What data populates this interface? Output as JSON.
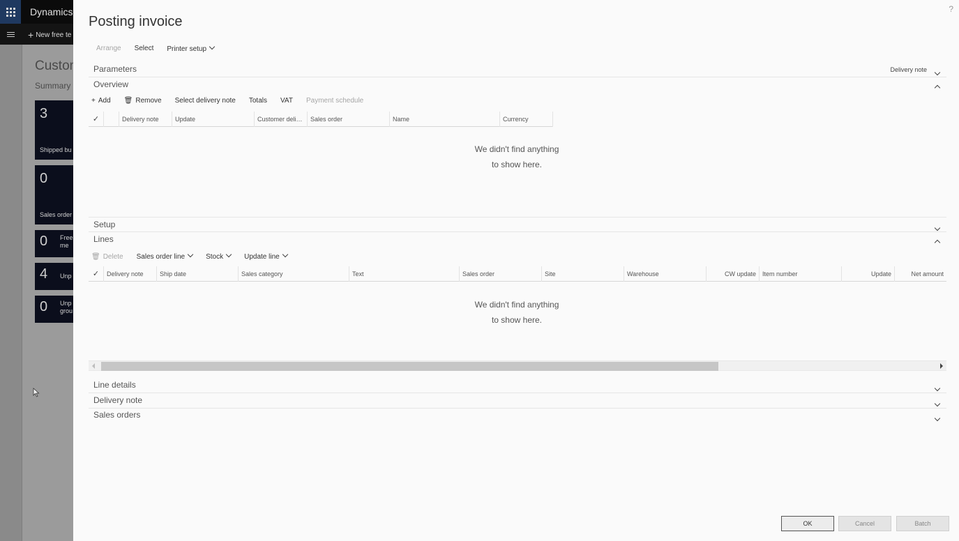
{
  "background": {
    "app_name": "Dynamics",
    "new_button": "New free te",
    "page_title": "Custon",
    "summary": "Summary",
    "tiles": [
      {
        "count": "3",
        "label": "Shipped bu"
      },
      {
        "count": "0",
        "label": "Sales order"
      },
      {
        "count": "0",
        "label": "Free me"
      },
      {
        "count": "4",
        "label": "Unp"
      },
      {
        "count": "0",
        "label": "Unp grou"
      }
    ]
  },
  "dialog": {
    "help": "?",
    "title": "Posting invoice",
    "actions": {
      "arrange": "Arrange",
      "select": "Select",
      "printer_setup": "Printer setup"
    },
    "parameters": {
      "title": "Parameters",
      "summary": "Delivery note"
    },
    "overview": {
      "title": "Overview",
      "toolbar": {
        "add": "Add",
        "remove": "Remove",
        "select_delivery_note": "Select delivery note",
        "totals": "Totals",
        "vat": "VAT",
        "payment_schedule": "Payment schedule"
      },
      "columns": [
        "Delivery note",
        "Update",
        "Customer delive...",
        "Sales order",
        "Name",
        "Currency"
      ],
      "empty_line1": "We didn't find anything",
      "empty_line2": "to show here."
    },
    "setup": {
      "title": "Setup"
    },
    "lines": {
      "title": "Lines",
      "toolbar": {
        "delete": "Delete",
        "sales_order_line": "Sales order line",
        "stock": "Stock",
        "update_line": "Update line"
      },
      "columns": [
        "Delivery note",
        "Ship date",
        "Sales category",
        "Text",
        "Sales order",
        "Site",
        "Warehouse",
        "CW update",
        "Item number",
        "Update",
        "Net amount"
      ],
      "empty_line1": "We didn't find anything",
      "empty_line2": "to show here."
    },
    "line_details": {
      "title": "Line details"
    },
    "delivery_note": {
      "title": "Delivery note"
    },
    "sales_orders": {
      "title": "Sales orders"
    },
    "buttons": {
      "ok": "OK",
      "cancel": "Cancel",
      "batch": "Batch"
    }
  }
}
